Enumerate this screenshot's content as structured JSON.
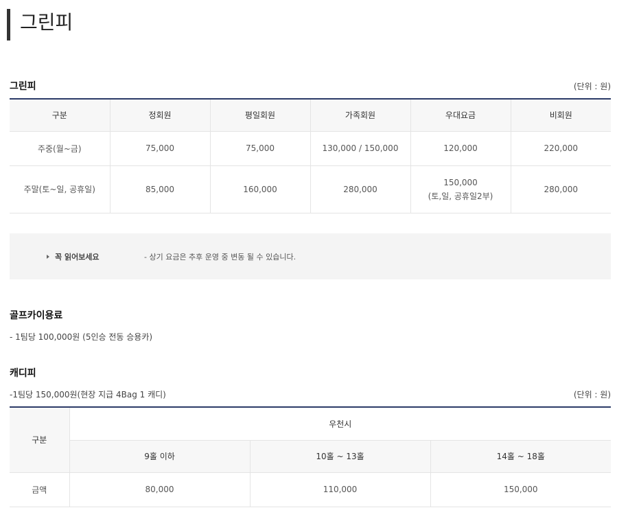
{
  "page": {
    "title": "그린피"
  },
  "greenfee": {
    "title": "그린피",
    "unit": "(단위 : 원)",
    "headers": [
      "구분",
      "정회원",
      "평일회원",
      "가족회원",
      "우대요금",
      "비회원"
    ],
    "rows": [
      [
        "주중(월~금)",
        "75,000",
        "75,000",
        "130,000 / 150,000",
        "120,000",
        "220,000"
      ],
      [
        "주말(토~일, 공휴일)",
        "85,000",
        "160,000",
        "280,000",
        "150,000",
        "280,000"
      ]
    ],
    "weekend_discount_note": "(토,일, 공휴일2부)"
  },
  "notice": {
    "label": "꼭 읽어보세요",
    "text": "- 상기 요금은 추후 운영 중 변동 될 수 있습니다."
  },
  "cart": {
    "title": "골프카이용료",
    "text": "- 1팀당 100,000원 (5인승 전동 승용카)"
  },
  "caddie": {
    "title": "캐디피",
    "text": "-1팀당 150,000원(현장 지급 4Bag 1 캐디)",
    "unit": "(단위 : 원)",
    "row_header": "구분",
    "group_header": "우천시",
    "sub_headers": [
      "9홀 이하",
      "10홀 ~ 13홀",
      "14홀 ~ 18홀"
    ],
    "row_label": "금액",
    "values": [
      "80,000",
      "110,000",
      "150,000"
    ]
  }
}
